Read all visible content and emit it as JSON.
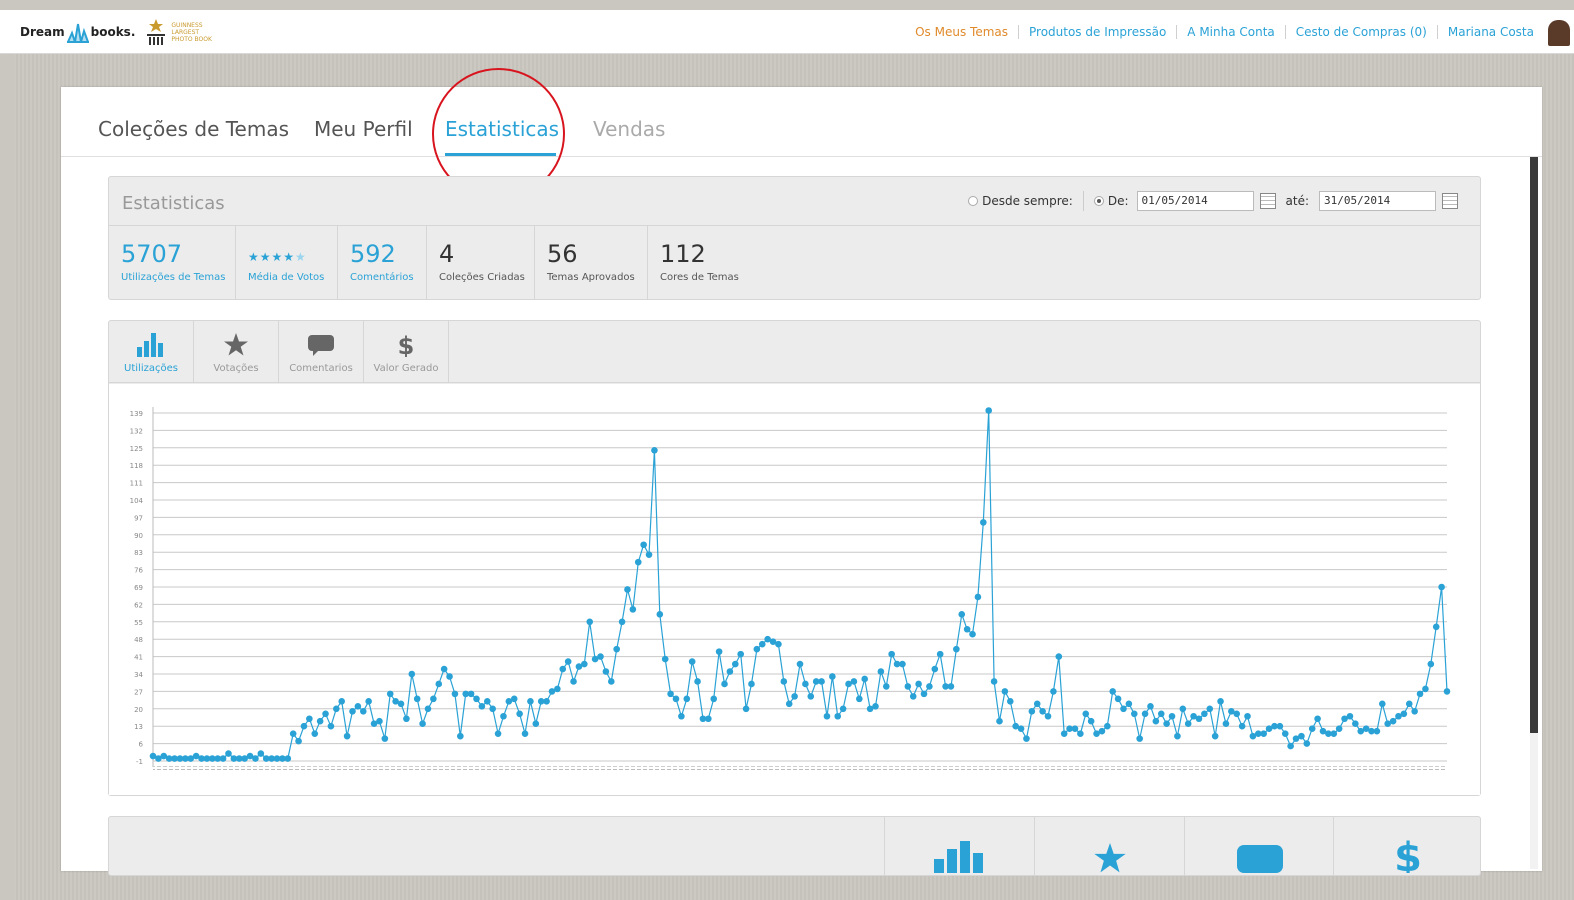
{
  "header": {
    "logo_text_left": "Dream",
    "logo_text_right": "books.",
    "guinness_line1": "GUINNESS",
    "guinness_line2": "LARGEST",
    "guinness_line3": "PHOTO BOOK",
    "nav": {
      "my_themes": "Os Meus Temas",
      "print_products": "Produtos de Impressão",
      "my_account": "A Minha Conta",
      "cart": "Cesto de Compras (0)",
      "user": "Mariana Costa"
    }
  },
  "tabs": {
    "collections": "Coleções de Temas",
    "profile": "Meu Perfil",
    "statistics": "Estatisticas",
    "sales": "Vendas"
  },
  "stats": {
    "title": "Estatisticas",
    "since_always": "Desde sempre:",
    "from_label": "De:",
    "from_value": "01/05/2014",
    "to_label": "até:",
    "to_value": "31/05/2014",
    "items": [
      {
        "value": "5707",
        "label": "Utilizações de Temas"
      },
      {
        "value": "",
        "label": "Média de Votos"
      },
      {
        "value": "592",
        "label": "Comentários"
      },
      {
        "value": "4",
        "label": "Coleções Criadas"
      },
      {
        "value": "56",
        "label": "Temas Aprovados"
      },
      {
        "value": "112",
        "label": "Cores de Temas"
      }
    ],
    "rating": 4
  },
  "chart_tabs": {
    "uses": "Utilizações",
    "votes": "Votações",
    "comments": "Comentarios",
    "value": "Valor Gerado"
  },
  "colors": {
    "accent": "#2aa2d6",
    "orange": "#e08a2b",
    "red_circle": "#d8141e"
  },
  "chart_data": {
    "type": "line",
    "title": "",
    "xlabel": "",
    "ylabel": "",
    "ylim": [
      -1,
      139
    ],
    "yticks": [
      -1,
      6,
      13,
      20,
      27,
      34,
      41,
      48,
      55,
      62,
      69,
      76,
      83,
      90,
      97,
      104,
      111,
      118,
      125,
      132,
      139
    ],
    "grid": true,
    "series": [
      {
        "values": [
          1,
          0,
          1,
          0,
          0,
          0,
          0,
          0,
          1,
          0,
          0,
          0,
          0,
          0,
          2,
          0,
          0,
          0,
          1,
          0,
          2,
          0,
          0,
          0,
          0,
          0,
          10,
          7,
          13,
          16,
          10,
          15,
          18,
          13,
          20,
          23,
          9,
          19,
          21,
          19,
          23,
          14,
          15,
          8,
          26,
          23,
          22,
          16,
          34,
          24,
          14,
          20,
          24,
          30,
          36,
          33,
          26,
          9,
          26,
          26,
          24,
          21,
          23,
          20,
          10,
          17,
          23,
          24,
          18,
          10,
          23,
          14,
          23,
          23,
          27,
          28,
          36,
          39,
          31,
          37,
          38,
          55,
          40,
          41,
          35,
          31,
          44,
          55,
          68,
          60,
          79,
          86,
          82,
          124,
          58,
          40,
          26,
          24,
          17,
          24,
          39,
          31,
          16,
          16,
          24,
          43,
          30,
          35,
          38,
          42,
          20,
          30,
          44,
          46,
          48,
          47,
          46,
          31,
          22,
          25,
          38,
          30,
          25,
          31,
          31,
          17,
          33,
          17,
          20,
          30,
          31,
          24,
          32,
          20,
          21,
          35,
          29,
          42,
          38,
          38,
          29,
          25,
          30,
          26,
          29,
          36,
          42,
          29,
          29,
          44,
          58,
          52,
          50,
          65,
          95,
          140,
          31,
          15,
          27,
          23,
          13,
          12,
          8,
          19,
          22,
          19,
          17,
          27,
          41,
          10,
          12,
          12,
          10,
          18,
          15,
          10,
          11,
          13,
          27,
          24,
          20,
          22,
          18,
          8,
          18,
          21,
          15,
          18,
          14,
          17,
          9,
          20,
          14,
          17,
          16,
          18,
          20,
          9,
          23,
          14,
          19,
          18,
          13,
          17,
          9,
          10,
          10,
          12,
          13,
          13,
          10,
          5,
          8,
          9,
          6,
          12,
          16,
          11,
          10,
          10,
          12,
          16,
          17,
          14,
          11,
          12,
          11,
          11,
          22,
          14,
          15,
          17,
          18,
          22,
          19,
          26,
          28,
          38,
          53,
          69,
          27
        ]
      }
    ]
  }
}
